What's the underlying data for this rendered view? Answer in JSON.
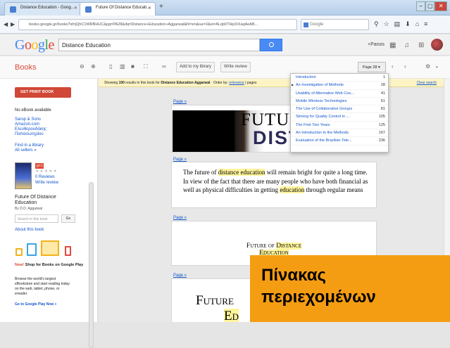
{
  "browser": {
    "tabs": [
      {
        "label": "Distance Education - Goog..."
      },
      {
        "label": "Future Of Distance Educati..."
      }
    ],
    "new_tab": "+",
    "url": "books.google.gr/books?id=jQhC1WRBHUC&pg=PA28&dq=Distance+Education+Aggarwal&hl=en&sa=X&ei=ALqb0THpXIXaqAeAB...",
    "url_host": "books.google.gr",
    "search_engine": "Google",
    "window_buttons": [
      "–",
      "▢",
      "✕"
    ]
  },
  "google": {
    "logo": "Google",
    "query": "Distance Education",
    "plus_name": "+Panos"
  },
  "books": {
    "label": "Books",
    "add_library": "Add to my library",
    "write_review": "Write review",
    "page_button": "Page 28 ▾"
  },
  "sidebar": {
    "get_print": "GET PRINT BOOK",
    "no_ebook": "No eBook available",
    "sellers": [
      "Sarup & Sons",
      "Amazon.com",
      "Ελευθερουδάκης",
      "Παπασωτηρίου"
    ],
    "find_library": "Find in a library",
    "all_sellers": "All sellers »",
    "reviews": "0 Reviews",
    "write_review": "Write review",
    "book_title_line1": "Future Of Distance",
    "book_title_line2": "Education",
    "author": "By D.D. Aggarwal",
    "search_placeholder": "Search in this book",
    "go": "Go",
    "about": "About this book",
    "promo_new": "New!",
    "promo_title": "Shop for Books on Google Play",
    "promo_l1": "Browse the world's largest",
    "promo_l2": "eBookstore and start reading today",
    "promo_l3": "on the web, tablet, phone, or",
    "promo_l4": "ereader.",
    "promo_link": "Go to Google Play Now »"
  },
  "notice": {
    "prefix": "Showing ",
    "count": "100",
    "mid": " results in this book for ",
    "query": "Distance Education Aggarwal",
    "order": " · Order by: ",
    "relevance": "relevance",
    "pages": " | pages",
    "clear": "Clear search"
  },
  "pages": {
    "link": "Page »",
    "p1_line1": "FUTUR",
    "p1_line2": "DISTA",
    "p2_html_parts": [
      "The future of ",
      "distance education",
      " will remain bright for quite a long time. In view of the fact that there are many people who have both financial as well as physical difficulties in getting ",
      "education",
      " through regular means"
    ],
    "p3_a": "Future of ",
    "p3_b": "Distance",
    "p3_c": "Education",
    "p4_a": "Future ",
    "p4_b": "Ed"
  },
  "toc": [
    {
      "title": "Introduction",
      "page": "1"
    },
    {
      "title": "An Investigation of Methods",
      "page": "28"
    },
    {
      "title": "Usability of Alternative Web Cou...",
      "page": "41"
    },
    {
      "title": "Mobile Wireless Technologies",
      "page": "61"
    },
    {
      "title": "The Use of Collaborative Groups",
      "page": "81"
    },
    {
      "title": "Striving for Quality Control in ...",
      "page": "105"
    },
    {
      "title": "The First Two Years",
      "page": "125"
    },
    {
      "title": "An Introduction to the Methods",
      "page": "167"
    },
    {
      "title": "Evaluation of the Brazilian Tele...",
      "page": "236"
    }
  ],
  "overlay": {
    "line1": "Πίνακας",
    "line2": "περιεχομένων"
  }
}
